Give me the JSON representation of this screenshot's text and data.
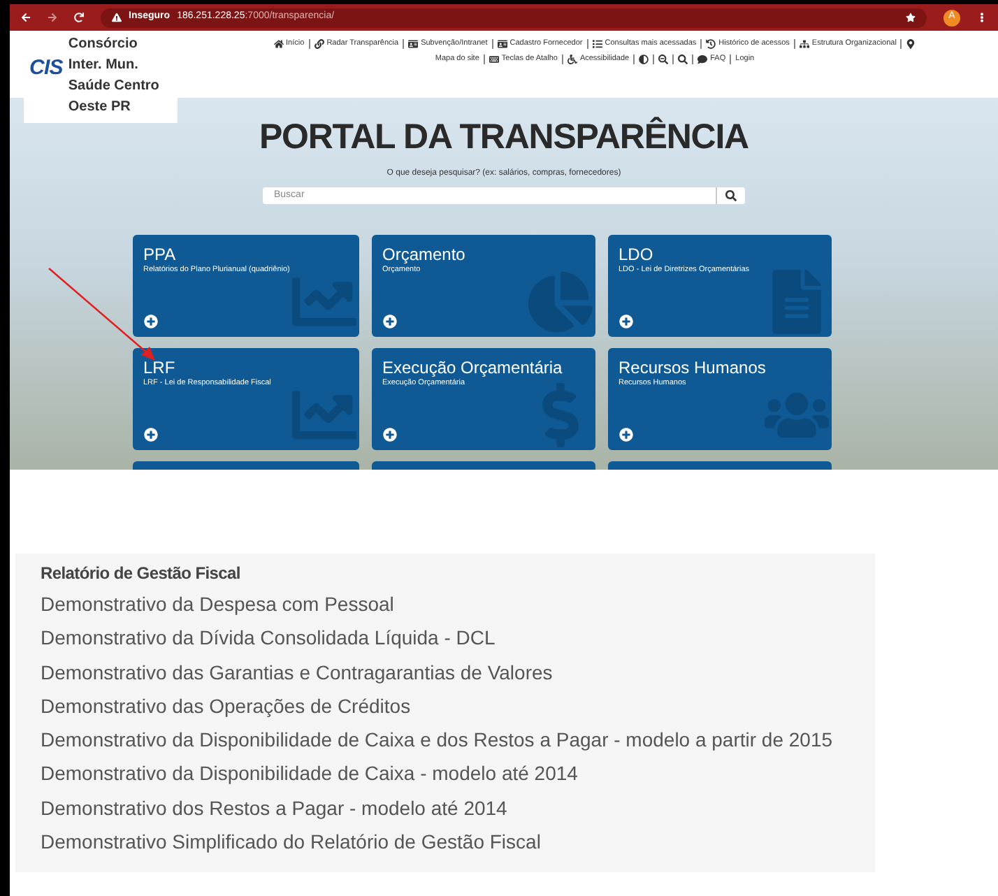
{
  "browser": {
    "security": "Inseguro",
    "host": "186.251.228.25",
    "path": ":7000/transparencia/",
    "profile": "A"
  },
  "header": {
    "logo_mark": "CIS",
    "org_name": "Consórcio Inter. Mun. Saúde Centro Oeste PR",
    "nav_rows": [
      [
        "Início",
        "Radar Transparência",
        "Subvenção/Intranet",
        "Cadastro Fornecedor",
        "Consultas mais acessadas",
        "Histórico de acessos",
        "Estrutura Organizacional"
      ],
      [
        "Mapa do site",
        "Teclas de Atalho",
        "Acessibilidade",
        "FAQ",
        "Login"
      ]
    ]
  },
  "hero": {
    "title": "PORTAL DA TRANSPARÊNCIA",
    "prompt": "O que deseja pesquisar? (ex: salários, compras, fornecedores)",
    "search": {
      "placeholder": "Buscar"
    }
  },
  "cards": [
    {
      "title": "PPA",
      "subtitle": "Relatórios do Plano Plurianual (quadriênio)"
    },
    {
      "title": "Orçamento",
      "subtitle": "Orçamento"
    },
    {
      "title": "LDO",
      "subtitle": "LDO - Lei de Diretrizes Orçamentárias"
    },
    {
      "title": "LRF",
      "subtitle": "LRF - Lei de Responsabilidade Fiscal"
    },
    {
      "title": "Execução Orçamentária",
      "subtitle": "Execução Orçamentária"
    },
    {
      "title": "Recursos Humanos",
      "subtitle": "Recursos Humanos"
    }
  ],
  "report_list": {
    "heading": "Relatório de Gestão Fiscal",
    "items": [
      "Demonstrativo da Despesa com Pessoal",
      "Demonstrativo da Dívida Consolidada Líquida - DCL",
      "Demonstrativo das Garantias e Contragarantias de Valores",
      "Demonstrativo das Operações de Créditos",
      "Demonstrativo da Disponibilidade de Caixa e dos Restos a Pagar - modelo a partir de 2015",
      "Demonstrativo da Disponibilidade de Caixa - modelo até 2014",
      "Demonstrativo dos Restos a Pagar - modelo até 2014",
      "Demonstrativo Simplificado do Relatório de Gestão Fiscal"
    ]
  }
}
